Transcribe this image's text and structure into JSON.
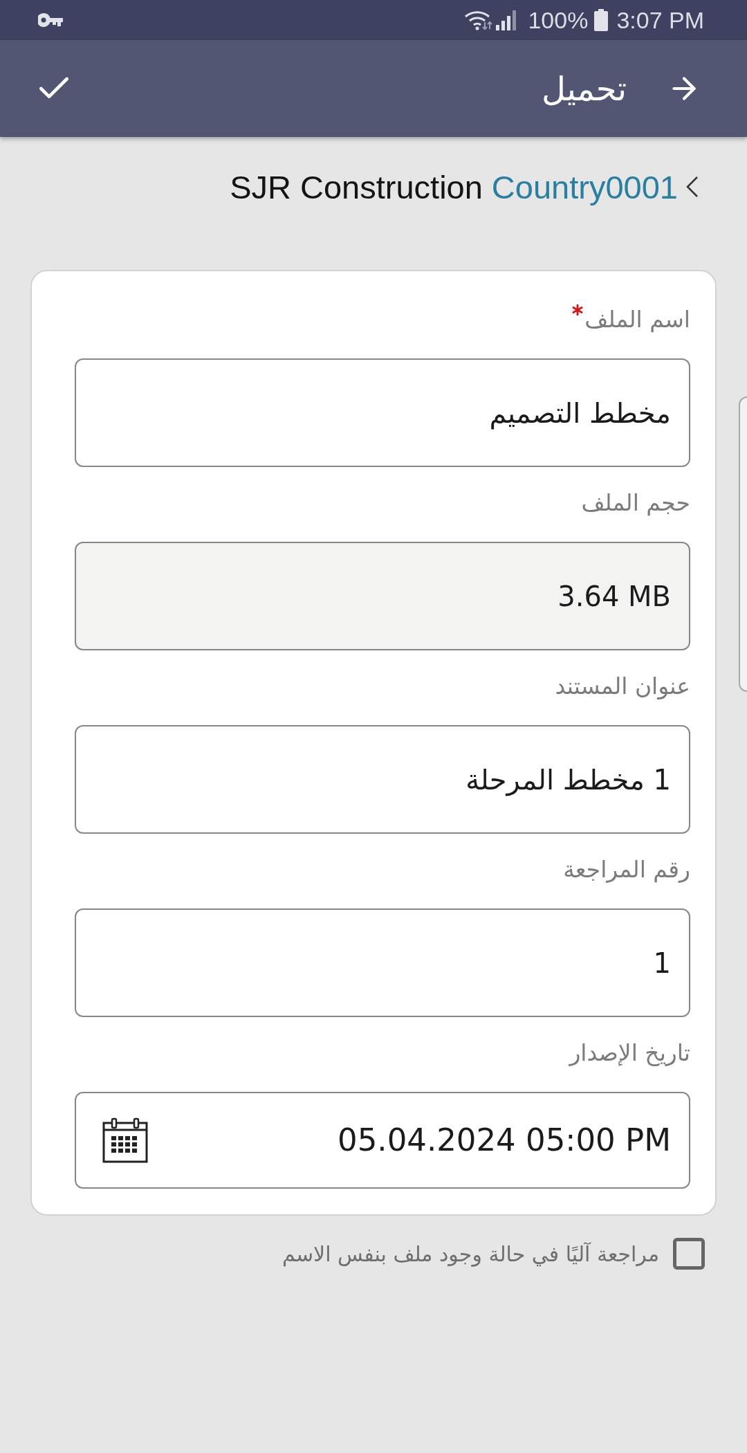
{
  "status_bar": {
    "battery": "100%",
    "time": "3:07 PM"
  },
  "header": {
    "title": "تحميل"
  },
  "breadcrumb": {
    "parent": "Country0001",
    "current": "SJR Construction"
  },
  "fields": [
    {
      "kind": "text",
      "label": "اسم الملف",
      "required": true,
      "disabled": false,
      "value": "مخطط التصميم"
    },
    {
      "kind": "text",
      "label": "حجم الملف",
      "required": false,
      "disabled": true,
      "value": "3.64 MB"
    },
    {
      "kind": "text",
      "label": "عنوان المستند",
      "required": false,
      "disabled": false,
      "value": "1 مخطط المرحلة"
    },
    {
      "kind": "text",
      "label": "رقم المراجعة",
      "required": false,
      "disabled": false,
      "value": "1"
    },
    {
      "kind": "date",
      "label": "تاريخ الإصدار",
      "required": false,
      "disabled": false,
      "value": "05.04.2024 05:00 PM"
    }
  ],
  "checkbox": {
    "label": "مراجعة آليًا في حالة وجود ملف بنفس الاسم",
    "checked": false
  }
}
